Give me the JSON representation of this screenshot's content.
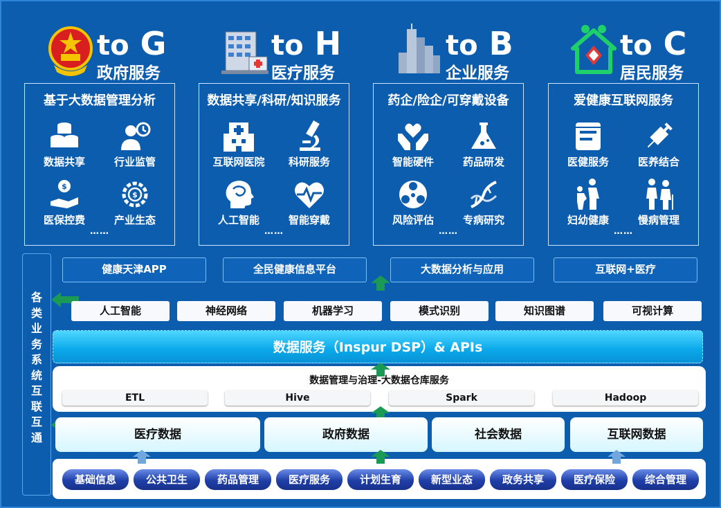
{
  "targets": [
    {
      "to": "to",
      "letter": "G",
      "label": "政府服务"
    },
    {
      "to": "to",
      "letter": "H",
      "label": "医疗服务"
    },
    {
      "to": "to",
      "letter": "B",
      "label": "企业服务"
    },
    {
      "to": "to",
      "letter": "C",
      "label": "居民服务"
    }
  ],
  "cards": [
    {
      "title": "基于大数据管理分析",
      "items": [
        "数据共享",
        "行业监管",
        "医保控费",
        "产业生态"
      ],
      "more": "……"
    },
    {
      "title": "数据共享/科研/知识服务",
      "items": [
        "互联网医院",
        "科研服务",
        "人工智能",
        "智能穿戴"
      ],
      "more": "……"
    },
    {
      "title": "药企/险企/可穿戴设备",
      "items": [
        "智能硬件",
        "药品研发",
        "风险评估",
        "专病研究"
      ],
      "more": "……"
    },
    {
      "title": "爱健康互联网服务",
      "items": [
        "医健服务",
        "医养结合",
        "妇幼健康",
        "慢病管理"
      ],
      "more": "……"
    }
  ],
  "sidebar": {
    "label": "各类业务系统互联互通"
  },
  "platforms": [
    "健康天津APP",
    "全民健康信息平台",
    "大数据分析与应用",
    "互联网+医疗"
  ],
  "tech": [
    "人工智能",
    "神经网络",
    "机器学习",
    "模式识别",
    "知识图谱",
    "可视计算"
  ],
  "dsp": {
    "label": "数据服务（Inspur DSP）& APIs"
  },
  "mgmt": {
    "title": "数据管理与治理-大数据仓库服务",
    "tools": [
      "ETL",
      "Hive",
      "Spark",
      "Hadoop"
    ]
  },
  "sources": [
    "医疗数据",
    "政府数据",
    "社会数据",
    "互联网数据"
  ],
  "categories": [
    "基础信息",
    "公共卫生",
    "药品管理",
    "医疗服务",
    "计划生育",
    "新型业态",
    "政务共享",
    "医疗保险",
    "综合管理"
  ],
  "colors": {
    "background": "#0d5daf",
    "accent_green": "#1a9a55",
    "arrow_blue": "#6fa7de",
    "band": "#0aa8ea",
    "pill": "#1f3fa8"
  }
}
